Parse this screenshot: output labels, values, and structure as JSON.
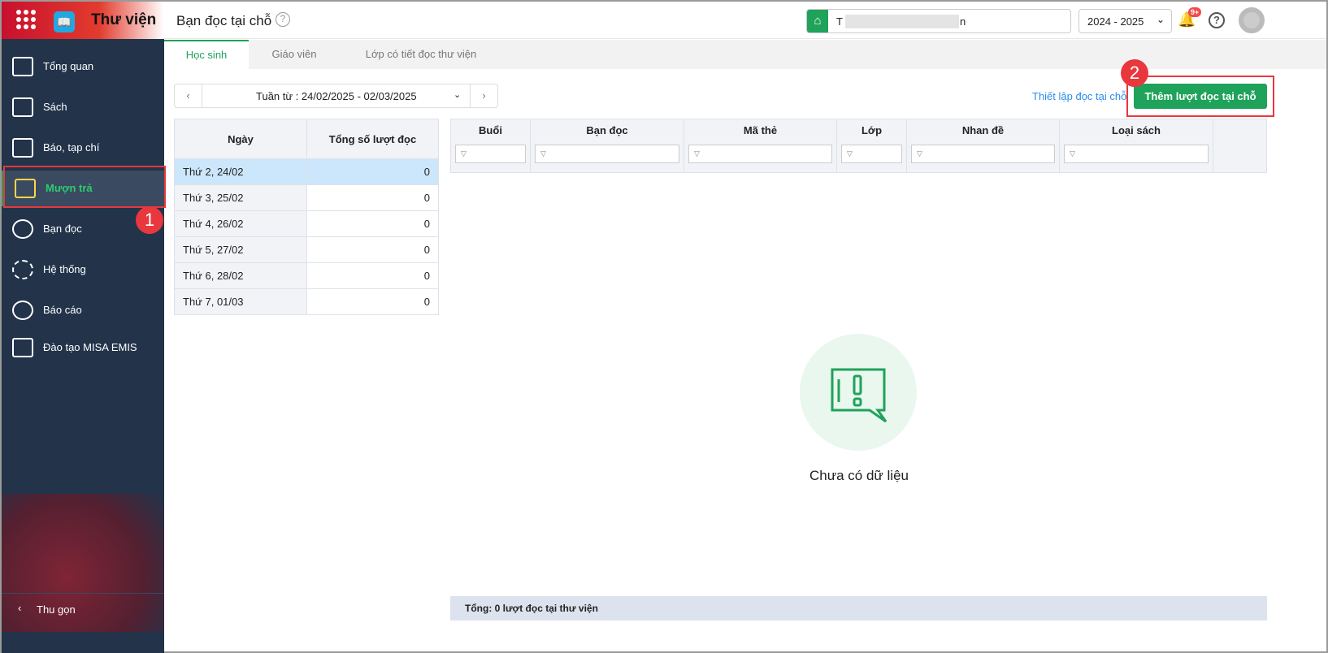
{
  "header": {
    "app_title": "Thư viện",
    "page_title": "Bạn đọc tại chỗ",
    "school_name_visible": "T",
    "school_name_end": "n",
    "year": "2024 - 2025",
    "notification_badge": "9+"
  },
  "sidebar": {
    "items": [
      {
        "label": "Tổng quan",
        "icon": "chart-bars-icon"
      },
      {
        "label": "Sách",
        "icon": "book-icon"
      },
      {
        "label": "Báo, tạp chí",
        "icon": "newspaper-icon"
      },
      {
        "label": "Mượn trả",
        "icon": "borrow-icon",
        "active": true
      },
      {
        "label": "Bạn đọc",
        "icon": "reader-icon"
      },
      {
        "label": "Hệ thống",
        "icon": "gear-icon"
      },
      {
        "label": "Báo cáo",
        "icon": "pie-chart-icon"
      },
      {
        "label": "Đào tạo MISA EMIS",
        "icon": "cube-icon"
      }
    ],
    "collapse_label": "Thu gọn"
  },
  "tabs": [
    {
      "label": "Học sinh",
      "active": true
    },
    {
      "label": "Giáo viên"
    },
    {
      "label": "Lớp có tiết đọc thư viện"
    }
  ],
  "week": {
    "value": "Tuần từ : 24/02/2025 - 02/03/2025"
  },
  "actions": {
    "setup_link": "Thiết lập đọc tại chỗ",
    "add_button": "Thêm lượt đọc tại chỗ"
  },
  "days_table": {
    "headers": [
      "Ngày",
      "Tổng số lượt đọc"
    ],
    "rows": [
      [
        "Thứ 2, 24/02",
        "0"
      ],
      [
        "Thứ 3, 25/02",
        "0"
      ],
      [
        "Thứ 4, 26/02",
        "0"
      ],
      [
        "Thứ 5, 27/02",
        "0"
      ],
      [
        "Thứ 6, 28/02",
        "0"
      ],
      [
        "Thứ 7, 01/03",
        "0"
      ]
    ]
  },
  "detail_table": {
    "headers": [
      "Buổi",
      "Bạn đọc",
      "Mã thẻ",
      "Lớp",
      "Nhan đề",
      "Loại sách"
    ]
  },
  "empty": {
    "text": "Chưa có dữ liệu"
  },
  "footer": {
    "total": "Tổng: 0 lượt đọc tại thư viện"
  },
  "callouts": [
    "1",
    "2"
  ],
  "colors": {
    "accent": "#1fa25a",
    "sidebar": "#22334a",
    "callout": "#e8383d",
    "link": "#2d8ceb"
  }
}
